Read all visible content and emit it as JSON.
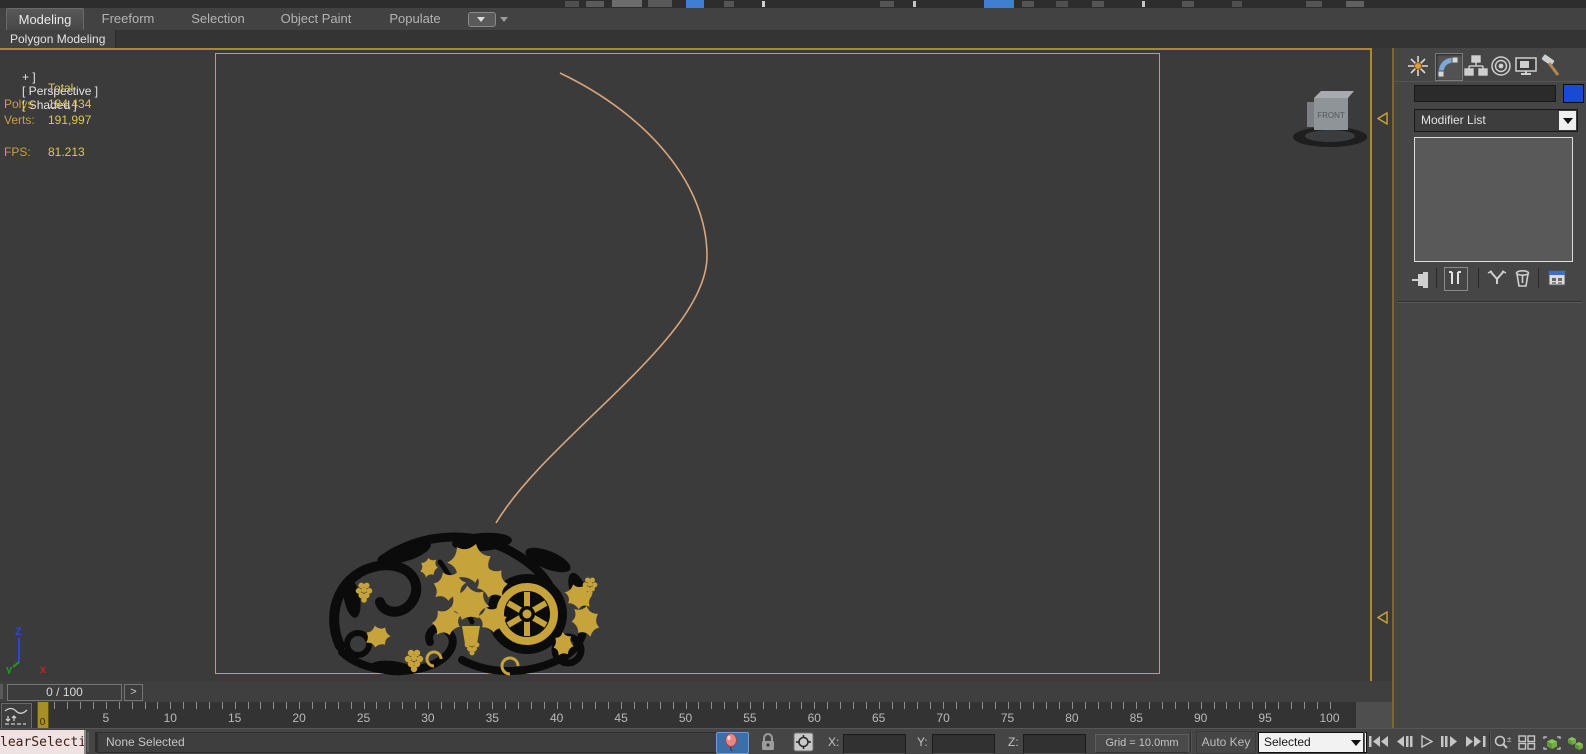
{
  "ribbon": {
    "tabs": [
      {
        "label": "Modeling",
        "active": true
      },
      {
        "label": "Freeform",
        "active": false
      },
      {
        "label": "Selection",
        "active": false
      },
      {
        "label": "Object Paint",
        "active": false
      },
      {
        "label": "Populate",
        "active": false
      }
    ],
    "panel_tab": "Polygon Modeling"
  },
  "viewport": {
    "menu_label": "+ ]",
    "pov_label": "[ Perspective ]",
    "shading_label": "[ Shaded ]",
    "stats": {
      "header": "Total",
      "rows": [
        {
          "label": "Polys:",
          "value": "184,434"
        },
        {
          "label": "Verts:",
          "value": "191,997"
        }
      ],
      "fps": {
        "label": "FPS:",
        "value": "81.213"
      }
    },
    "viewcube_face": "FRONT",
    "axis_labels": {
      "x": "x",
      "y": "y",
      "z": "Z"
    }
  },
  "command_panel": {
    "tabs": [
      "create",
      "modify",
      "hierarchy",
      "motion",
      "display",
      "utilities"
    ],
    "active_tab": "modify",
    "name_field_value": "",
    "modifier_list_label": "Modifier List"
  },
  "timeline": {
    "slider_value": "0 / 100",
    "advance_button": ">",
    "start": 0,
    "end": 100,
    "label_step": 5,
    "current_frame": 0
  },
  "status_bar": {
    "maxscript_text": "learSelectio",
    "prompt": "None Selected",
    "coords": [
      {
        "label": "X:",
        "value": ""
      },
      {
        "label": "Y:",
        "value": ""
      },
      {
        "label": "Z:",
        "value": ""
      }
    ],
    "grid_text": "Grid = 10.0mm",
    "auto_key": "Auto Key",
    "key_filter_value": "Selected"
  },
  "colors": {
    "viewport_border": "#a98b2c",
    "safe_frame": "#c9a43b",
    "stats_label": "#c9a03a",
    "stats_value": "#d9c84a",
    "spline": "#d9a57c",
    "ornament_gold": "#c7a33b",
    "ornament_black": "#0b0b0b",
    "isolate_active_bg": "#3c6ea8",
    "color_swatch": "#1a49d8"
  }
}
